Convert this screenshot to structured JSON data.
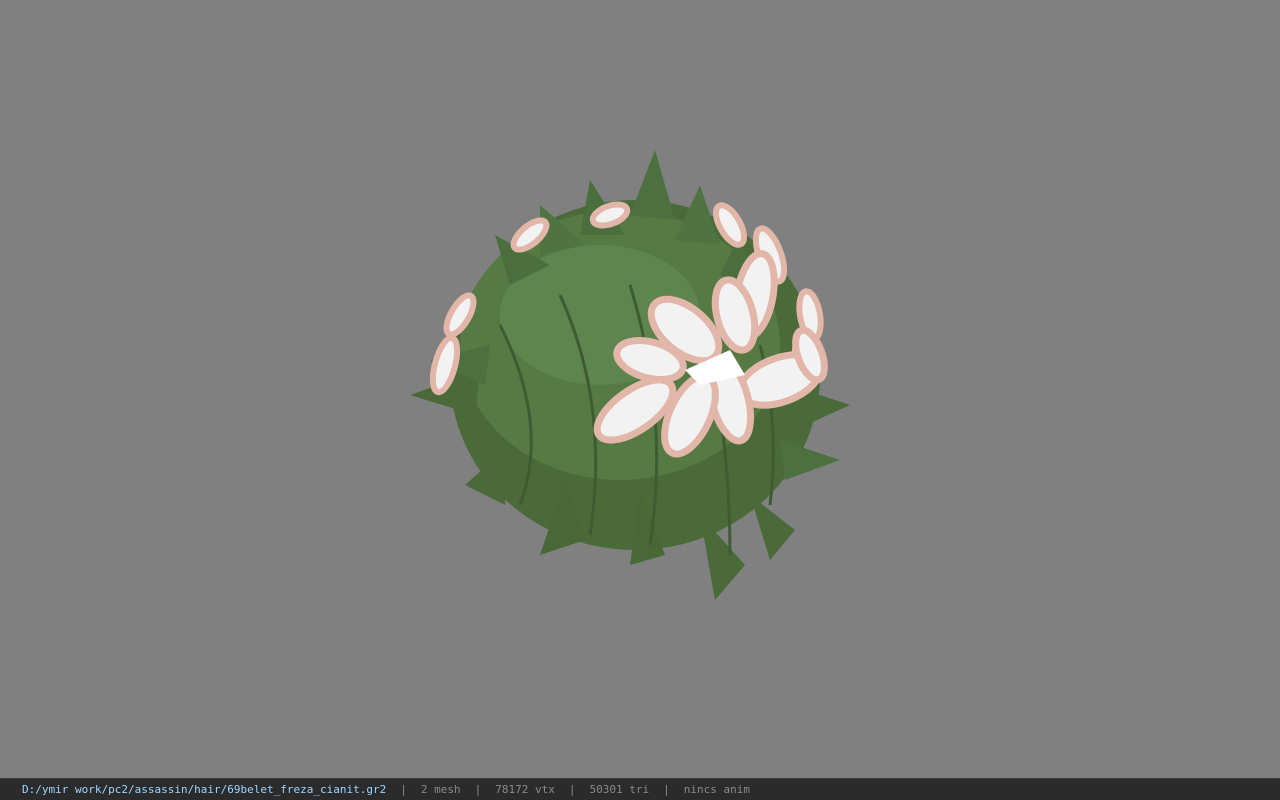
{
  "viewport": {
    "background_color": "#808080",
    "model": {
      "description_icon": "hair-mesh",
      "hair_color": "#4f6f3f",
      "hair_highlight": "#63864f",
      "petal_fill": "#f2f2f2",
      "petal_edge": "#e3b6aa"
    }
  },
  "status_bar": {
    "file_path": "D:/ymir work/pc2/assassin/hair/69belet_freza_cianit.gr2",
    "separator": "|",
    "mesh_count": "2 mesh",
    "vertex_count": "78172 vtx",
    "triangle_count": "50301 tri",
    "animation": "nincs anim",
    "path_color": "#9fd4ff",
    "text_color": "#8a8a8a",
    "background_color": "#2b2b2b"
  }
}
